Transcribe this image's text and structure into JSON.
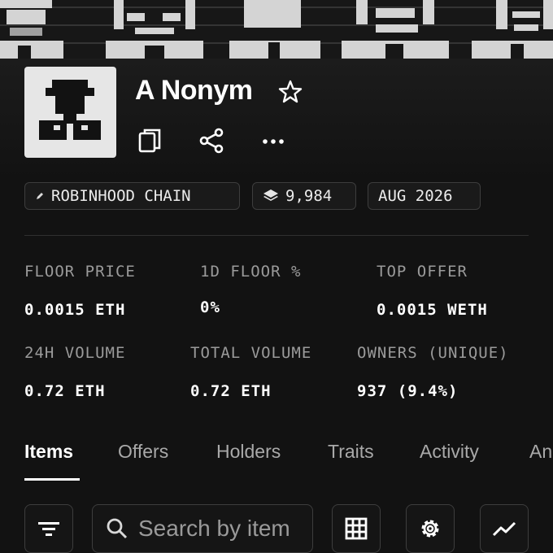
{
  "collection": {
    "name": "A Nonym",
    "badges": [
      {
        "icon": "pencil-icon",
        "label": "ROBINHOOD CHAIN"
      },
      {
        "icon": "layers-icon",
        "label": "9,984"
      },
      {
        "icon": "",
        "label": "AUG 2026"
      }
    ]
  },
  "stats": [
    {
      "label": "FLOOR PRICE",
      "value": "0.0015 ETH"
    },
    {
      "label": "1D FLOOR %",
      "value": "0%"
    },
    {
      "label": "TOP OFFER",
      "value": "0.0015 WETH"
    },
    {
      "label": "24H VOLUME",
      "value": "0.72 ETH"
    },
    {
      "label": "TOTAL VOLUME",
      "value": "0.72 ETH"
    },
    {
      "label": "OWNERS (UNIQUE)",
      "value": "937 (9.4%)"
    }
  ],
  "tabs": [
    "Items",
    "Offers",
    "Holders",
    "Traits",
    "Activity",
    "An"
  ],
  "active_tab": "Items",
  "search": {
    "placeholder": "Search by item"
  },
  "colors": {
    "background": "#121212",
    "muted_text": "#9b9b9b",
    "border": "#3d3d3d"
  }
}
